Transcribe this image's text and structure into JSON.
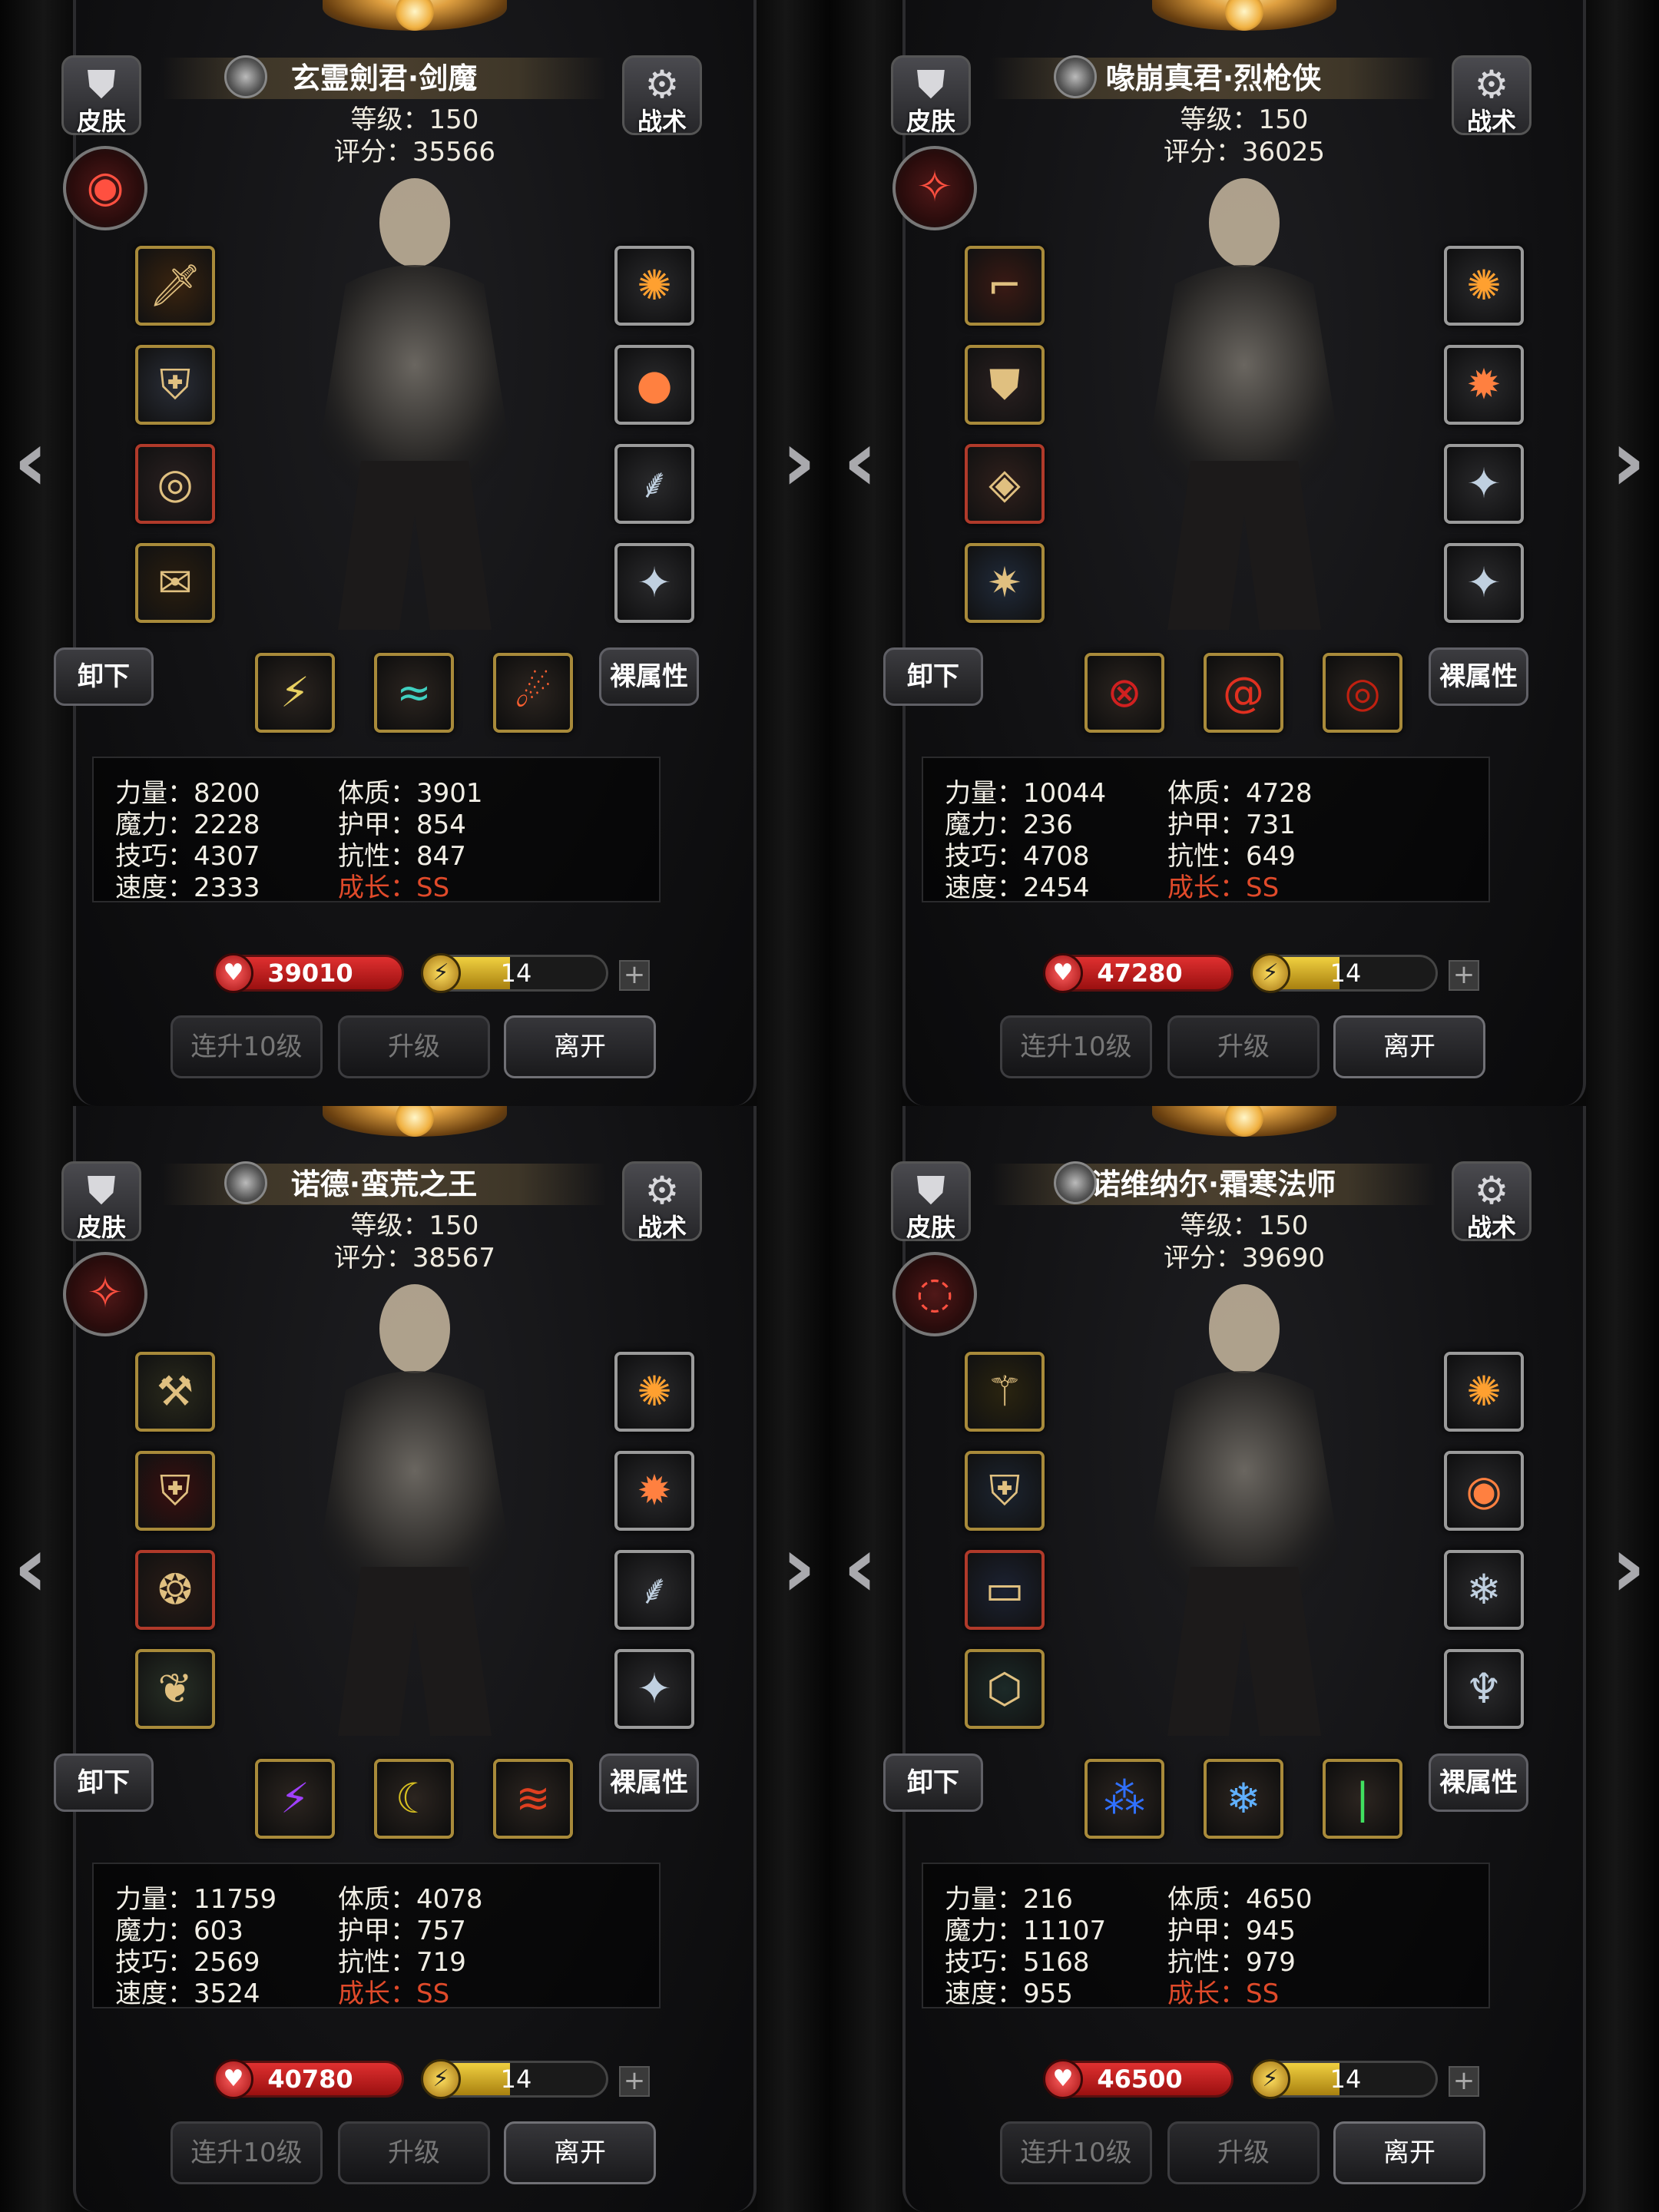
{
  "common": {
    "skin_label": "皮肤",
    "tactics_label": "战术",
    "unequip_label": "卸下",
    "bare_attr_label": "裸属性",
    "lvl_prefix": "等级：",
    "score_prefix": "评分：",
    "btn_up10": "连升10级",
    "btn_up": "升级",
    "btn_leave": "离开",
    "growth_label": "成长：",
    "growth_value": "SS",
    "stat_labels": [
      "力量：",
      "魔力：",
      "技巧：",
      "速度：",
      "体质：",
      "护甲：",
      "抗性："
    ],
    "energy_max": 30,
    "colors": {
      "hp": "#d02a2a",
      "energy": "#e0c030",
      "growth": "#e04a2a"
    }
  },
  "panels": [
    {
      "name": "玄霊劍君·剑魔",
      "level": "150",
      "score": "35566",
      "stats": {
        "str": "8200",
        "mag": "2228",
        "skl": "4307",
        "spd": "2333",
        "con": "3901",
        "arm": "854",
        "res": "847"
      },
      "hp": "39010",
      "energy": "14",
      "portrait": "armored-knight-woman",
      "class_icon": "eye-emblem-icon",
      "equip_left": [
        "sword-icon",
        "chest-armor-icon",
        "ring-icon",
        "scroll-icon"
      ],
      "equip_right": [
        "flame-crest-icon",
        "glowing-orb-icon",
        "feather-icon",
        "pendant-icon"
      ],
      "skills": [
        "light-slash-icon",
        "wind-slash-icon",
        "fire-slash-icon"
      ]
    },
    {
      "name": "喙崩真君·烈枪侠",
      "level": "150",
      "score": "36025",
      "stats": {
        "str": "10044",
        "mag": "236",
        "skl": "4708",
        "spd": "2454",
        "con": "4728",
        "arm": "731",
        "res": "649"
      },
      "hp": "47280",
      "energy": "14",
      "portrait": "plague-doctor",
      "class_icon": "fire-claw-emblem-icon",
      "equip_left": [
        "pistol-icon",
        "leather-coat-icon",
        "dark-bracer-icon",
        "flame-gun-icon"
      ],
      "equip_right": [
        "flame-crest-icon",
        "fire-orb-icon",
        "pendant-icon",
        "pendant-icon"
      ],
      "skills": [
        "crosshair-icon",
        "vortex-icon",
        "target-icon"
      ]
    },
    {
      "name": "诺德·蛮荒之王",
      "level": "150",
      "score": "38567",
      "stats": {
        "str": "11759",
        "mag": "603",
        "skl": "2569",
        "spd": "3524",
        "con": "4078",
        "arm": "757",
        "res": "719"
      },
      "hp": "40780",
      "energy": "14",
      "portrait": "barbarian-wolf-pelt",
      "class_icon": "fire-claw-emblem-icon",
      "equip_left": [
        "axe-emblem-icon",
        "blue-armor-icon",
        "rune-circle-icon",
        "demon-heart-icon"
      ],
      "equip_right": [
        "flame-crest-icon",
        "fire-orb-icon",
        "feather-icon",
        "pendant-icon"
      ],
      "skills": [
        "purple-slash-icon",
        "golden-arc-icon",
        "fire-claw-icon"
      ]
    },
    {
      "name": "诺维纳尔·霜寒法师",
      "level": "150",
      "score": "39690",
      "stats": {
        "str": "216",
        "mag": "11107",
        "skl": "5168",
        "spd": "955",
        "con": "4650",
        "arm": "945",
        "res": "979"
      },
      "hp": "46500",
      "energy": "14",
      "portrait": "elf-mage-green-cloak",
      "class_icon": "arcane-swirl-emblem-icon",
      "equip_left": [
        "staff-icon",
        "golden-armor-icon",
        "belt-icon",
        "teal-amulet-icon"
      ],
      "equip_right": [
        "flame-crest-icon",
        "ice-orb-icon",
        "frost-crystal-icon",
        "lantern-icon"
      ],
      "skills": [
        "ice-shard-icon",
        "frost-storm-icon",
        "green-beam-icon"
      ]
    }
  ]
}
